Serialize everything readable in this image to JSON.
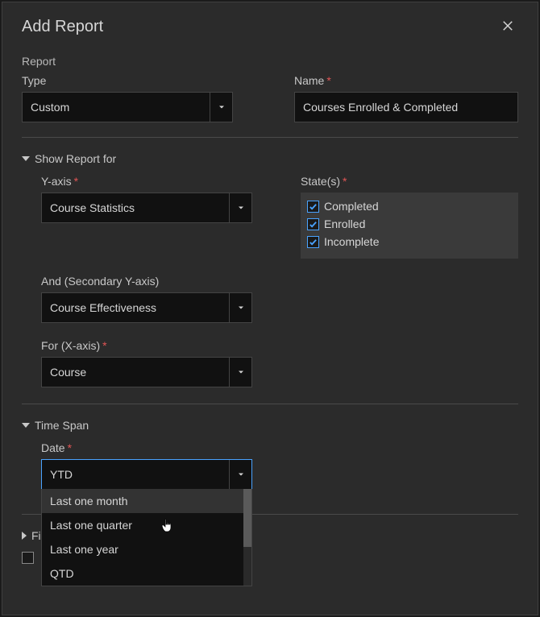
{
  "modal": {
    "title": "Add Report"
  },
  "report": {
    "section_label": "Report",
    "type_label": "Type",
    "type_value": "Custom",
    "name_label": "Name",
    "name_value": "Courses Enrolled & Completed"
  },
  "show_for": {
    "header": "Show Report for",
    "yaxis_label": "Y-axis",
    "yaxis_value": "Course Statistics",
    "states_label": "State(s)",
    "states": [
      {
        "label": "Completed",
        "checked": true
      },
      {
        "label": "Enrolled",
        "checked": true
      },
      {
        "label": "Incomplete",
        "checked": true
      }
    ],
    "secondary_label": "And (Secondary Y-axis)",
    "secondary_value": "Course Effectiveness",
    "xaxis_label": "For (X-axis)",
    "xaxis_value": "Course"
  },
  "time_span": {
    "header": "Time Span",
    "date_label": "Date",
    "date_value": "YTD",
    "options": [
      "Last one month",
      "Last one quarter",
      "Last one year",
      "QTD"
    ],
    "hover_index": 0
  },
  "filter": {
    "header_partial": "Fi"
  }
}
